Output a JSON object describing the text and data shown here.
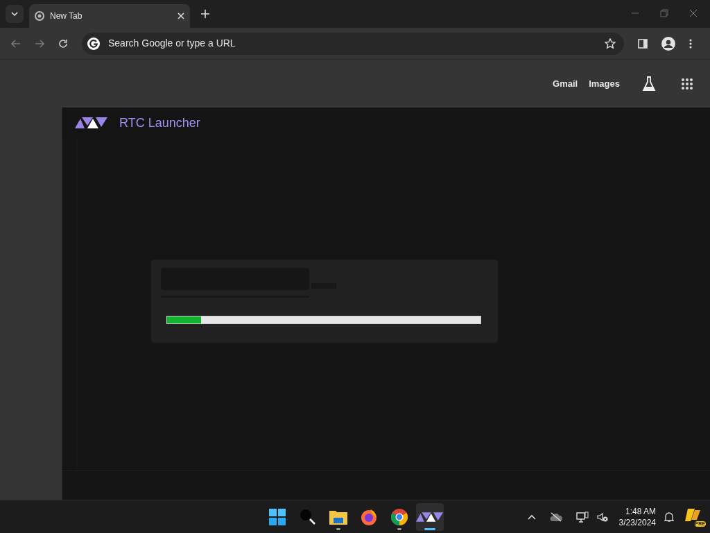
{
  "browser": {
    "tabs": [
      {
        "title": "New Tab",
        "selected": true
      }
    ],
    "address_bar": {
      "placeholder": "Search Google or type a URL"
    },
    "links": [
      "Gmail",
      "Images"
    ]
  },
  "launcher": {
    "title": "RTC Launcher",
    "progress": {
      "level": 0.11
    }
  },
  "taskbar": {
    "apps": [
      {
        "kind": "start",
        "running": false,
        "active": false
      },
      {
        "kind": "search",
        "running": false,
        "active": false
      },
      {
        "kind": "files",
        "running": true,
        "active": false
      },
      {
        "kind": "firefox",
        "running": false,
        "active": false
      },
      {
        "kind": "chrome",
        "running": true,
        "active": false
      },
      {
        "kind": "launcher",
        "running": true,
        "active": true
      }
    ],
    "time": "1:48 AM",
    "date": "3/23/2024",
    "badge": "PRE"
  }
}
